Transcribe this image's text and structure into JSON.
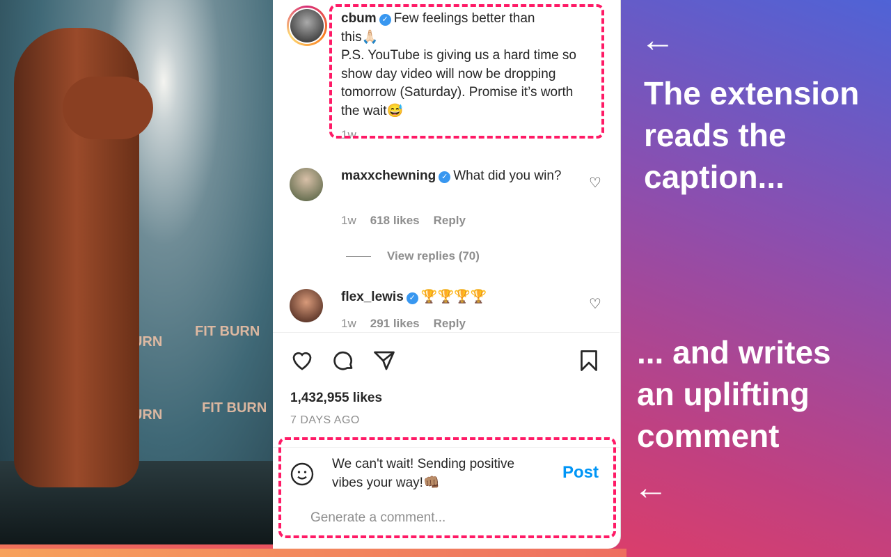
{
  "caption": {
    "username": "cbum",
    "text_line1": "Few feelings better than",
    "text_rest": "this🙏🏻\nP.S. YouTube is giving us a hard time so show day video will now be dropping tomorrow (Saturday). Promise it’s worth the wait😅",
    "time": "1w"
  },
  "comments": [
    {
      "username": "maxxchewning",
      "text": "What did you win?",
      "time": "1w",
      "likes": "618 likes",
      "reply": "Reply",
      "view_replies": "View replies (70)"
    },
    {
      "username": "flex_lewis",
      "text": "🏆🏆🏆🏆",
      "time": "1w",
      "likes": "291 likes",
      "reply": "Reply"
    }
  ],
  "post": {
    "likes": "1,432,955 likes",
    "date": "7 DAYS AGO"
  },
  "composer": {
    "value": "We can't wait! Sending positive vibes your way!👊🏽",
    "post_label": "Post",
    "placeholder": "Generate a comment..."
  },
  "photo": {
    "banner": "FIT BURN"
  },
  "promo": {
    "top": "The extension reads the caption...",
    "bottom": "... and writes an uplifting comment"
  },
  "colors": {
    "highlight": "#ff1a66",
    "link": "#0095f6"
  }
}
